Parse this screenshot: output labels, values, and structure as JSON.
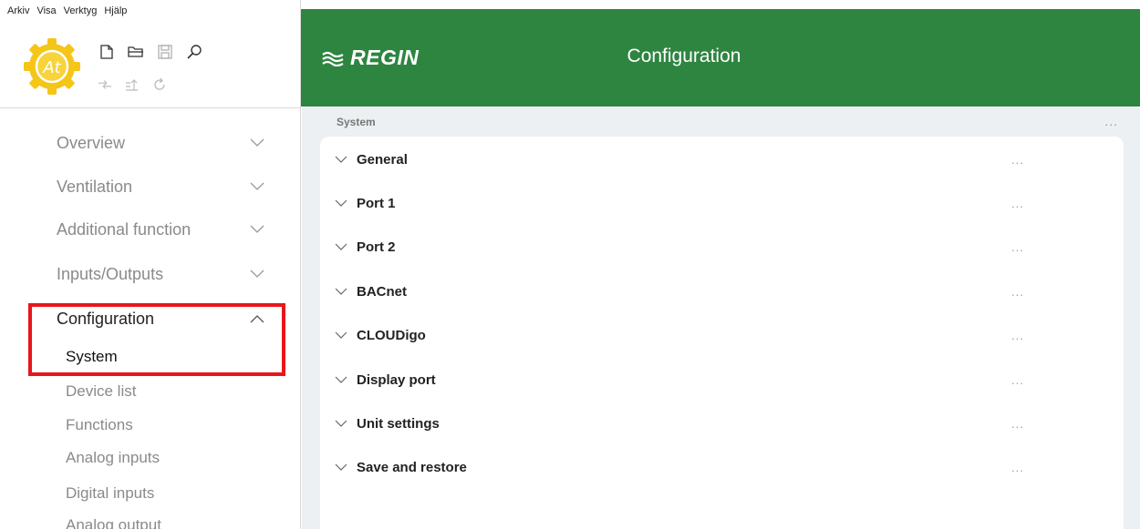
{
  "menubar": {
    "items": [
      "Arkiv",
      "Visa",
      "Verktyg",
      "Hjälp"
    ]
  },
  "toolbar": {
    "row1": [
      "new-file-icon",
      "open-folder-icon",
      "save-icon",
      "search-icon"
    ],
    "row2": [
      "connect-icon",
      "upload-icon",
      "refresh-icon"
    ],
    "logo_text": "At"
  },
  "header": {
    "brand": "REGIN",
    "title": "Configuration",
    "color": "#2e8540"
  },
  "nav": {
    "items": [
      {
        "label": "Overview",
        "expanded": false
      },
      {
        "label": "Ventilation",
        "expanded": false
      },
      {
        "label": "Additional function",
        "expanded": false
      },
      {
        "label": "Inputs/Outputs",
        "expanded": false
      },
      {
        "label": "Configuration",
        "expanded": true
      }
    ],
    "sub_items": [
      "System",
      "Device list",
      "Functions",
      "Analog inputs",
      "Digital inputs",
      "Analog output"
    ],
    "active_sub": "System"
  },
  "main": {
    "breadcrumb": "System",
    "more": "...",
    "sections": [
      {
        "label": "General",
        "more": "..."
      },
      {
        "label": "Port 1",
        "more": "..."
      },
      {
        "label": "Port 2",
        "more": "..."
      },
      {
        "label": "BACnet",
        "more": "..."
      },
      {
        "label": "CLOUDigo",
        "more": "..."
      },
      {
        "label": "Display port",
        "more": "..."
      },
      {
        "label": "Unit settings",
        "more": "..."
      },
      {
        "label": "Save and restore",
        "more": "..."
      }
    ]
  },
  "colors": {
    "highlight": "#e8161b",
    "background": "#edf0f2"
  }
}
